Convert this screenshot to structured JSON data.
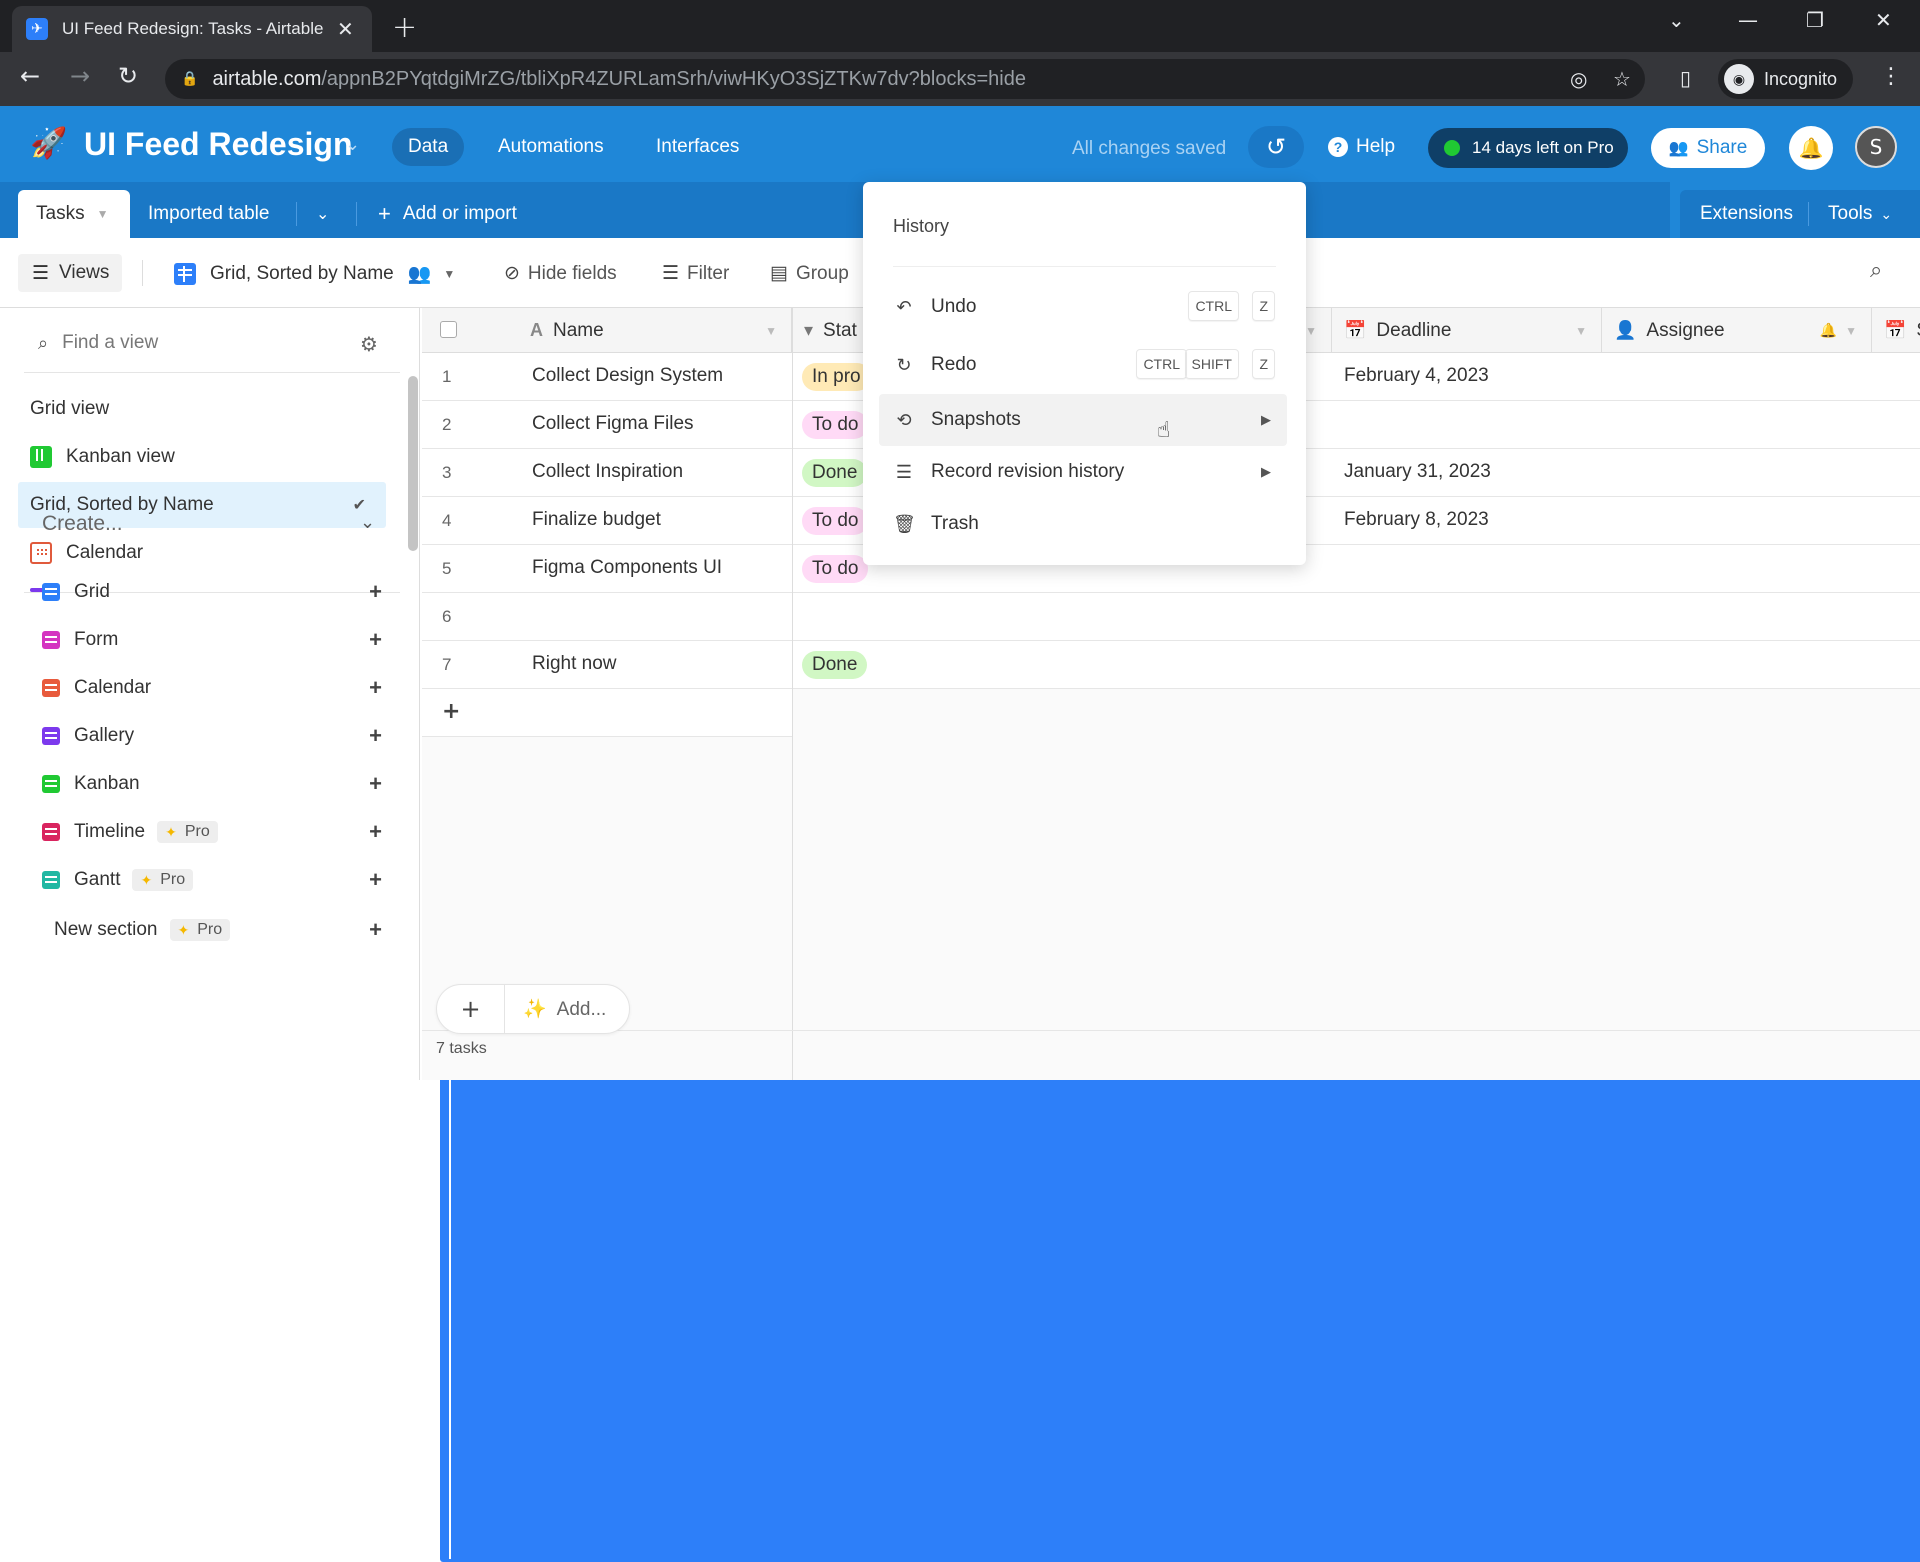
{
  "browser": {
    "tab_title": "UI Feed Redesign: Tasks - Airtable",
    "new_tab_icon": "plus-icon",
    "url_host": "airtable.com",
    "url_path": "/appnB2PYqtdgiMrZG/tbliXpR4ZURLamSrh/viwHKyO3SjZTKw7dv?blocks=hide",
    "profile_label": "Incognito"
  },
  "header": {
    "base_name": "UI Feed Redesign",
    "nav": [
      {
        "label": "Data",
        "active": true
      },
      {
        "label": "Automations",
        "active": false
      },
      {
        "label": "Interfaces",
        "active": false
      }
    ],
    "save_status": "All changes saved",
    "help_label": "Help",
    "trial_label": "14 days left on Pro",
    "share_label": "Share",
    "avatar_initial": "S",
    "colors": {
      "brand": "#1f87d8",
      "trial_bg": "#0f3f67",
      "trial_dot": "#20c933"
    }
  },
  "table_tabs": {
    "tabs": [
      {
        "label": "Tasks",
        "active": true
      },
      {
        "label": "Imported table",
        "active": false
      }
    ],
    "add_label": "Add or import",
    "extensions_label": "Extensions",
    "tools_label": "Tools"
  },
  "view_toolbar": {
    "views_label": "Views",
    "current_view": "Grid, Sorted by Name",
    "hide_fields_label": "Hide fields",
    "filter_label": "Filter",
    "group_label": "Group"
  },
  "sidebar": {
    "find_placeholder": "Find a view",
    "views": [
      {
        "label": "Grid view",
        "type": "grid",
        "active": false
      },
      {
        "label": "Kanban view",
        "type": "kanban",
        "active": false
      },
      {
        "label": "Grid, Sorted by Name",
        "type": "grid",
        "active": true
      },
      {
        "label": "Calendar",
        "type": "calendar",
        "active": false
      }
    ],
    "create_label": "Create...",
    "create_items": [
      {
        "label": "Grid",
        "color": "#2d7ff9",
        "pro": false
      },
      {
        "label": "Form",
        "color": "#d435c1",
        "pro": false
      },
      {
        "label": "Calendar",
        "color": "#e85a3c",
        "pro": false
      },
      {
        "label": "Gallery",
        "color": "#7c39ed",
        "pro": false
      },
      {
        "label": "Kanban",
        "color": "#20c933",
        "pro": false
      },
      {
        "label": "Timeline",
        "color": "#d9245f",
        "pro": true
      },
      {
        "label": "Gantt",
        "color": "#20b8a3",
        "pro": true
      }
    ],
    "new_section_label": "New section",
    "pro_label": "Pro"
  },
  "grid": {
    "columns": [
      {
        "label": "Name",
        "icon": "text-icon"
      },
      {
        "label": "Status",
        "icon": "single-select-icon"
      },
      {
        "label": "Deadline",
        "icon": "calendar-icon"
      },
      {
        "label": "Assignee",
        "icon": "user-icon"
      },
      {
        "label": "S",
        "icon": "calendar-icon"
      }
    ],
    "status_header_visible": "Stat",
    "rows": [
      {
        "num": "1",
        "name": "Collect Design System",
        "status": "In progress",
        "status_visible": "In pro",
        "deadline": "February 4, 2023"
      },
      {
        "num": "2",
        "name": "Collect Figma Files",
        "status": "To do",
        "status_visible": "To do",
        "deadline": ""
      },
      {
        "num": "3",
        "name": "Collect Inspiration",
        "status": "Done",
        "status_visible": "Done",
        "deadline": "January 31, 2023"
      },
      {
        "num": "4",
        "name": "Finalize budget",
        "status": "To do",
        "status_visible": "To do",
        "deadline": "February 8, 2023"
      },
      {
        "num": "5",
        "name": "Figma Components UI",
        "status": "To do",
        "status_visible": "To do",
        "deadline": ""
      },
      {
        "num": "6",
        "name": "",
        "status": "",
        "status_visible": "",
        "deadline": ""
      },
      {
        "num": "7",
        "name": "Right now",
        "status": "Done",
        "status_visible": "Done",
        "deadline": ""
      }
    ],
    "status_colors": {
      "In progress": "#ffeab6",
      "To do": "#ffdaf6",
      "Done": "#d1f7c4"
    },
    "add_label": "Add...",
    "record_count": "7 tasks"
  },
  "history_menu": {
    "title": "History",
    "items": [
      {
        "label": "Undo",
        "icon": "undo-icon",
        "shortcut": [
          "CTRL",
          "Z"
        ],
        "submenu": false
      },
      {
        "label": "Redo",
        "icon": "redo-icon",
        "shortcut": [
          "CTRL",
          "SHIFT",
          "Z"
        ],
        "submenu": false
      },
      {
        "label": "Snapshots",
        "icon": "history-icon",
        "shortcut": [],
        "submenu": true,
        "hover": true
      },
      {
        "label": "Record revision history",
        "icon": "list-icon",
        "shortcut": [],
        "submenu": true
      },
      {
        "label": "Trash",
        "icon": "trash-icon",
        "shortcut": [],
        "submenu": false
      }
    ]
  }
}
